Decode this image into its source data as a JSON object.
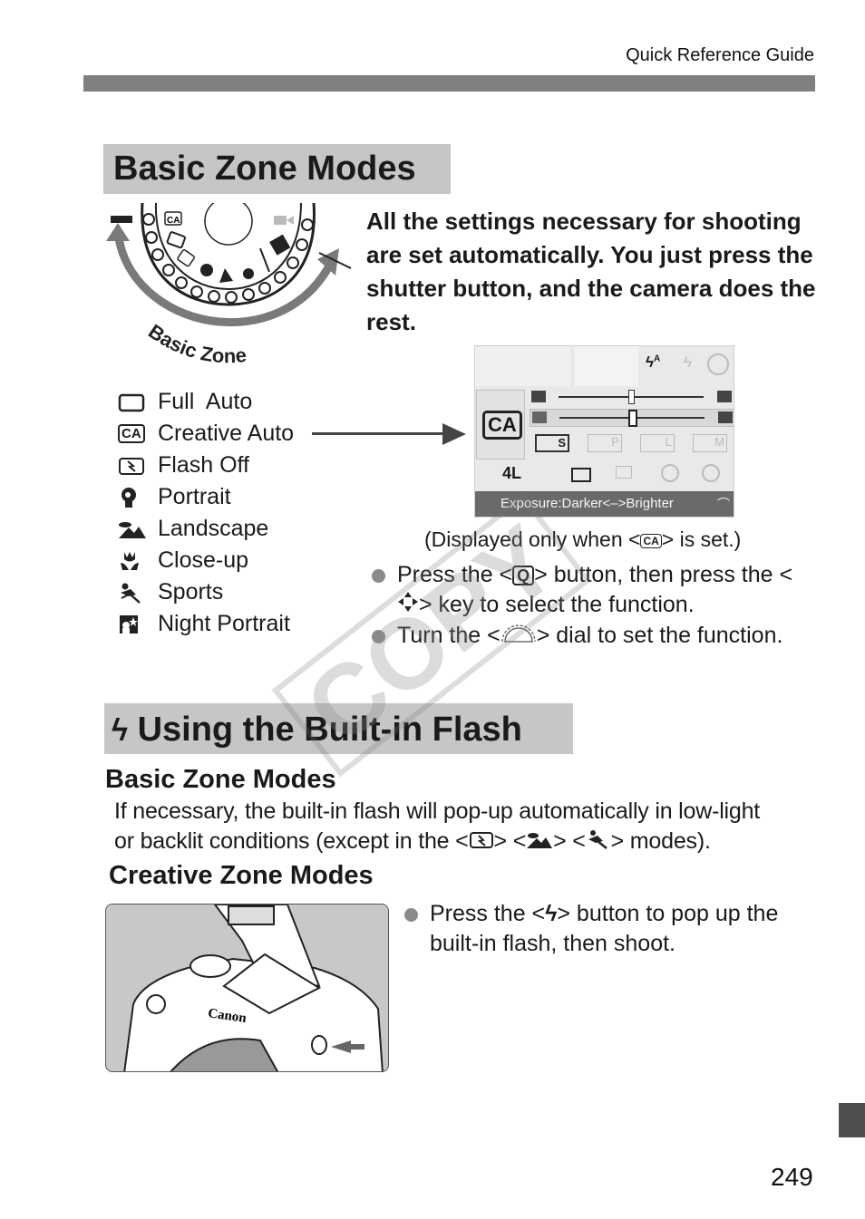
{
  "header": {
    "title": "Quick Reference Guide"
  },
  "section1": {
    "title": "Basic Zone Modes",
    "dial_label": "Basic Zone",
    "intro": "All the settings necessary for shooting are set automatically. You just press the shutter button, and the camera does the rest.",
    "modes": [
      {
        "icon": "full-auto-icon",
        "label": "Full  Auto"
      },
      {
        "icon": "creative-auto-icon",
        "label": "Creative Auto"
      },
      {
        "icon": "flash-off-icon",
        "label": "Flash Off"
      },
      {
        "icon": "portrait-icon",
        "label": "Portrait"
      },
      {
        "icon": "landscape-icon",
        "label": "Landscape"
      },
      {
        "icon": "close-up-icon",
        "label": "Close-up"
      },
      {
        "icon": "sports-icon",
        "label": "Sports"
      },
      {
        "icon": "night-portrait-icon",
        "label": "Night Portrait"
      }
    ],
    "lcd": {
      "mode_badge": "CA",
      "flash_options": [
        "4A",
        "4",
        "off"
      ],
      "drive_quality": "4L",
      "status_text": "Exposure:Darker<–>Brighter",
      "ambience_options": [
        "S",
        "P",
        "L",
        "M"
      ]
    },
    "caption_prefix": "(Displayed only when <",
    "caption_icon": "CA",
    "caption_suffix": "> is set.)",
    "bullets": [
      {
        "pre": "Press the <",
        "icon": "Q",
        "mid": "> button, then press the <",
        "icon2": "cross-keys",
        "post": "> key to select the function."
      },
      {
        "pre": "Turn the <",
        "icon": "main-dial",
        "post": "> dial to set the function."
      }
    ]
  },
  "section2": {
    "title": "Using the Built-in Flash",
    "basic": {
      "heading": "Basic Zone Modes",
      "line1": "If necessary, the built-in flash will pop-up automatically in low-light",
      "line2_pre": "or backlit conditions (except in the <",
      "line2_post": "> modes)."
    },
    "creative": {
      "heading": "Creative Zone Modes",
      "bullet_pre": "Press the <",
      "bullet_post": "> button to pop up the built-in flash, then shoot."
    },
    "photo_brand": "Canon"
  },
  "watermark": "COPY",
  "page_number": "249"
}
